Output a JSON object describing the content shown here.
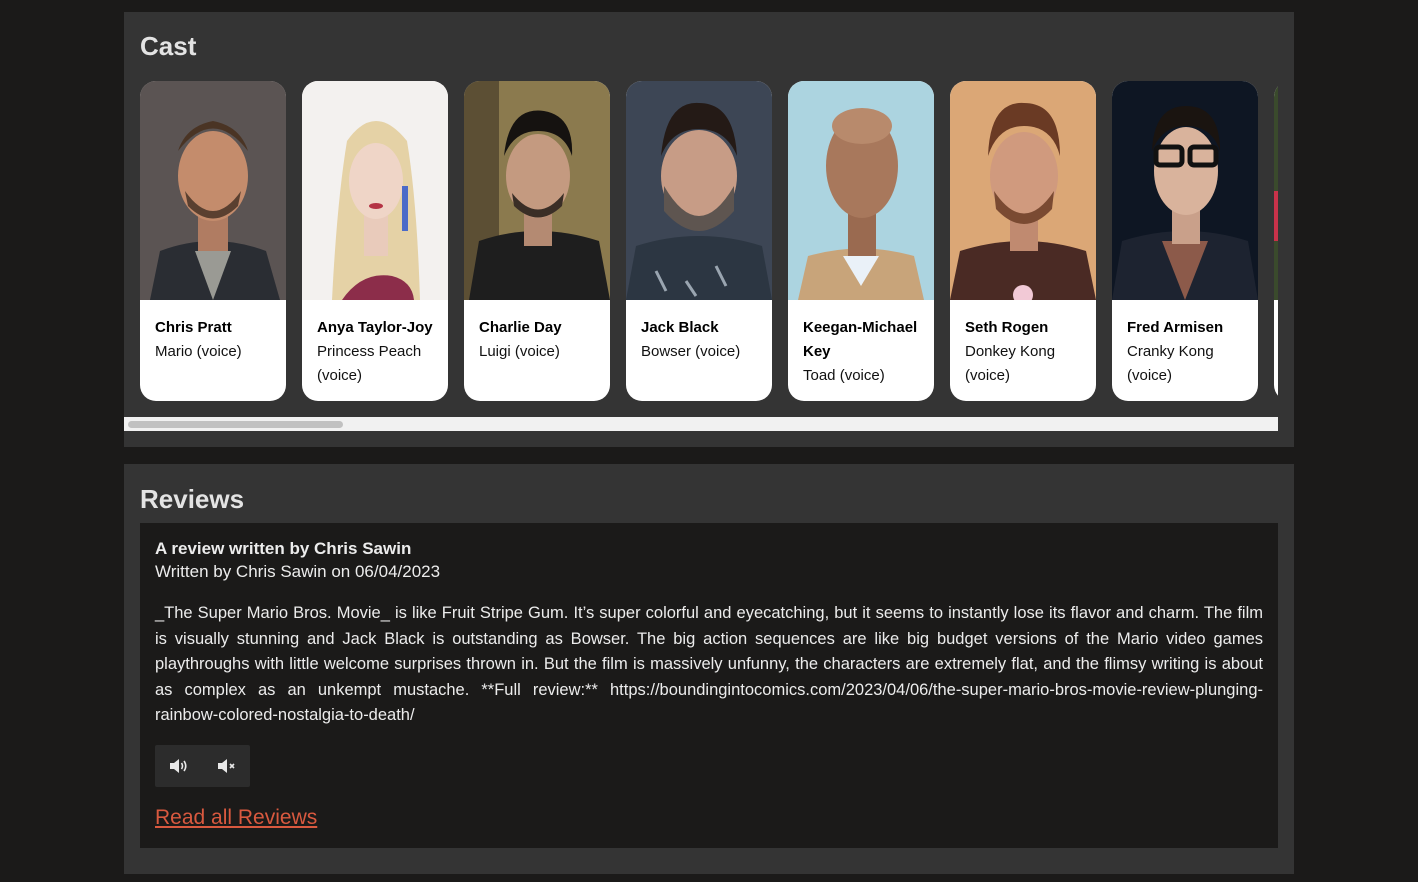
{
  "cast": {
    "title": "Cast",
    "members": [
      {
        "name": "Chris Pratt",
        "role": "Mario (voice)"
      },
      {
        "name": "Anya Taylor-Joy",
        "role": "Princess Peach (voice)"
      },
      {
        "name": "Charlie Day",
        "role": "Luigi (voice)"
      },
      {
        "name": "Jack Black",
        "role": "Bowser (voice)"
      },
      {
        "name": "Keegan-Michael Key",
        "role": "Toad (voice)"
      },
      {
        "name": "Seth Rogen",
        "role": "Donkey Kong (voice)"
      },
      {
        "name": "Fred Armisen",
        "role": "Cranky Kong (voice)"
      }
    ]
  },
  "reviews": {
    "title": "Reviews",
    "review": {
      "heading": "A review written by Chris Sawin",
      "meta": "Written by Chris Sawin on 06/04/2023",
      "body": "_The Super Mario Bros. Movie_ is like Fruit Stripe Gum. It’s super colorful and eyecatching, but it seems to instantly lose its flavor and charm. The film is visually stunning and Jack Black is outstanding as Bowser. The big action sequences are like big budget versions of the Mario video games playthroughs with little welcome surprises thrown in. But the film is massively unfunny, the characters are extremely flat, and the flimsy writing is about as complex as an unkempt mustache. **Full review:** https://boundingintocomics.com/2023/04/06/the-super-mario-bros-movie-review-plunging-rainbow-colored-nostalgia-to-death/"
    },
    "audio": {
      "speak_icon": "speaker-icon",
      "mute_icon": "mute-icon"
    },
    "read_all_label": "Read all Reviews"
  },
  "colors": {
    "page_bg": "#1b1a19",
    "panel_bg": "#343434",
    "link": "#d9593f"
  }
}
